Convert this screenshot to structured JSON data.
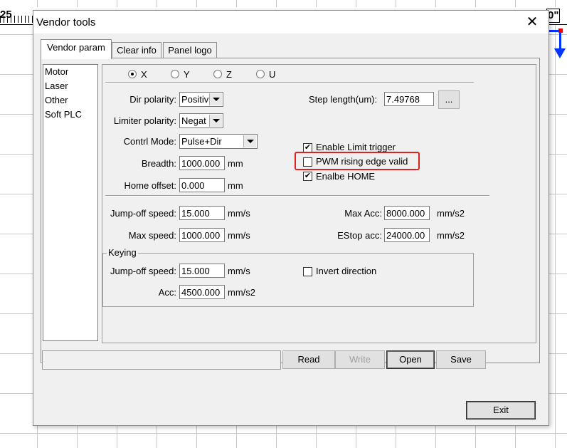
{
  "background": {
    "ruler_left_label": "25",
    "ruler_right_label": "0\"",
    "axis_color": "#0033ff",
    "origin_color": "#e00000"
  },
  "dialog": {
    "title": "Vendor tools",
    "close_icon": "close-icon",
    "close_symbol": "✕",
    "tabs": [
      {
        "label": "Vendor param",
        "active": true
      },
      {
        "label": "Clear info",
        "active": false
      },
      {
        "label": "Panel logo",
        "active": false
      }
    ],
    "list": [
      "Motor",
      "Laser",
      "Other",
      "Soft PLC"
    ],
    "axes": [
      {
        "label": "X",
        "selected": true
      },
      {
        "label": "Y",
        "selected": false
      },
      {
        "label": "Z",
        "selected": false
      },
      {
        "label": "U",
        "selected": false
      }
    ],
    "dir_polarity": {
      "label": "Dir polarity:",
      "value": "Positiv"
    },
    "limiter_polarity": {
      "label": "Limiter polarity:",
      "value": "Negat"
    },
    "control_mode": {
      "label": "Contrl Mode:",
      "value": "Pulse+Dir"
    },
    "breadth": {
      "label": "Breadth:",
      "value": "1000.000",
      "unit": "mm"
    },
    "home_offset": {
      "label": "Home offset:",
      "value": "0.000",
      "unit": "mm"
    },
    "step_length": {
      "label": "Step length(um):",
      "value": "7.49768",
      "button": "..."
    },
    "checks": {
      "enable_limit_trigger": {
        "label": "Enable Limit trigger",
        "checked": true
      },
      "pwm_rising_edge_valid": {
        "label": "PWM rising edge valid",
        "checked": false
      },
      "enable_home": {
        "label": "Enalbe HOME",
        "checked": true
      }
    },
    "highlight_color": "#e02020",
    "jump_off_speed": {
      "label": "Jump-off speed:",
      "value": "15.000",
      "unit": "mm/s"
    },
    "max_speed": {
      "label": "Max speed:",
      "value": "1000.000",
      "unit": "mm/s"
    },
    "max_acc": {
      "label": "Max Acc:",
      "value": "8000.000",
      "unit": "mm/s2"
    },
    "estop_acc": {
      "label": "EStop acc:",
      "value": "24000.00",
      "unit": "mm/s2"
    },
    "keying": {
      "title": "Keying",
      "jump_off_speed": {
        "label": "Jump-off speed:",
        "value": "15.000",
        "unit": "mm/s"
      },
      "acc": {
        "label": "Acc:",
        "value": "4500.000",
        "unit": "mm/s2"
      },
      "invert_direction": {
        "label": "Invert direction",
        "checked": false
      }
    },
    "buttons": {
      "read": "Read",
      "write": "Write",
      "open": "Open",
      "save": "Save",
      "exit": "Exit"
    }
  }
}
